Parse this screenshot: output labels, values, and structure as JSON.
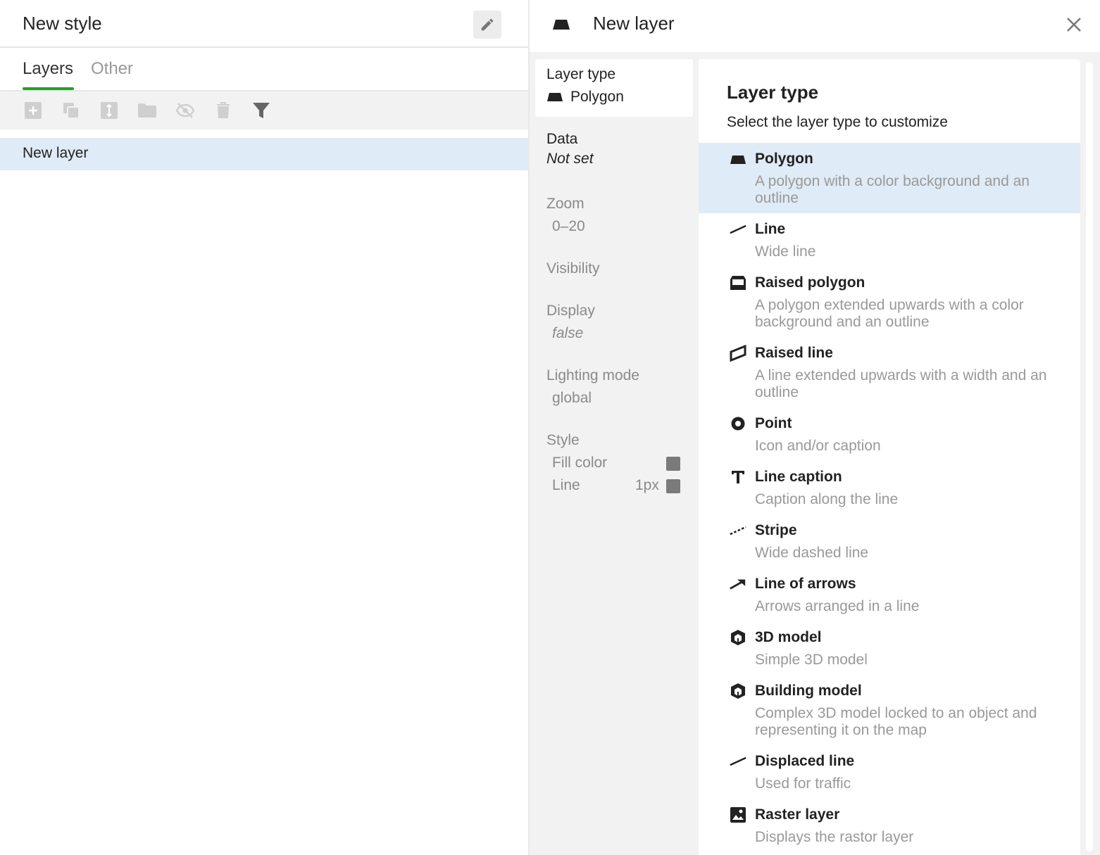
{
  "style": {
    "title": "New style",
    "tabs": [
      "Layers",
      "Other"
    ],
    "active_tab": "Layers",
    "toolbar_icons": [
      "add-icon",
      "duplicate-icon",
      "resize-icon",
      "folder-icon",
      "hide-icon",
      "delete-icon",
      "filter-icon"
    ],
    "layers": [
      "New layer"
    ]
  },
  "layer_panel": {
    "title": "New layer",
    "properties": {
      "layer_type_label": "Layer type",
      "layer_type_value": "Polygon",
      "data_label": "Data",
      "data_value": "Not set",
      "zoom_label": "Zoom",
      "zoom_value": "0–20",
      "visibility_label": "Visibility",
      "display_label": "Display",
      "display_value": "false",
      "lighting_label": "Lighting mode",
      "lighting_value": "global",
      "style_label": "Style",
      "fill_color_label": "Fill color",
      "line_label": "Line",
      "line_width": "1px",
      "swatch_color": "#7a7a7a"
    },
    "type_list": {
      "title": "Layer type",
      "subtitle": "Select the layer type to customize",
      "selected": "Polygon",
      "items": [
        {
          "name": "Polygon",
          "desc": "A polygon with a color background and an outline",
          "icon": "polygon-icon"
        },
        {
          "name": "Line",
          "desc": "Wide line",
          "icon": "line-icon"
        },
        {
          "name": "Raised polygon",
          "desc": "A polygon extended upwards with a color background and an outline",
          "icon": "raised-polygon-icon"
        },
        {
          "name": "Raised line",
          "desc": "A line extended upwards with a width and an outline",
          "icon": "raised-line-icon"
        },
        {
          "name": "Point",
          "desc": "Icon and/or caption",
          "icon": "point-icon"
        },
        {
          "name": "Line caption",
          "desc": "Caption along the line",
          "icon": "text-icon"
        },
        {
          "name": "Stripe",
          "desc": "Wide dashed line",
          "icon": "dashed-line-icon"
        },
        {
          "name": "Line of arrows",
          "desc": "Arrows arranged in a line",
          "icon": "arrow-icon"
        },
        {
          "name": "3D model",
          "desc": "Simple 3D model",
          "icon": "cube-icon"
        },
        {
          "name": "Building model",
          "desc": "Complex 3D model locked to an object and representing it on the map",
          "icon": "cube-icon"
        },
        {
          "name": "Displaced line",
          "desc": "Used for traffic",
          "icon": "line-icon"
        },
        {
          "name": "Raster layer",
          "desc": "Displays the rastor layer",
          "icon": "image-icon"
        }
      ]
    }
  },
  "colors": {
    "accent_green": "#1ea31e",
    "selection_blue": "#dfebf6"
  }
}
